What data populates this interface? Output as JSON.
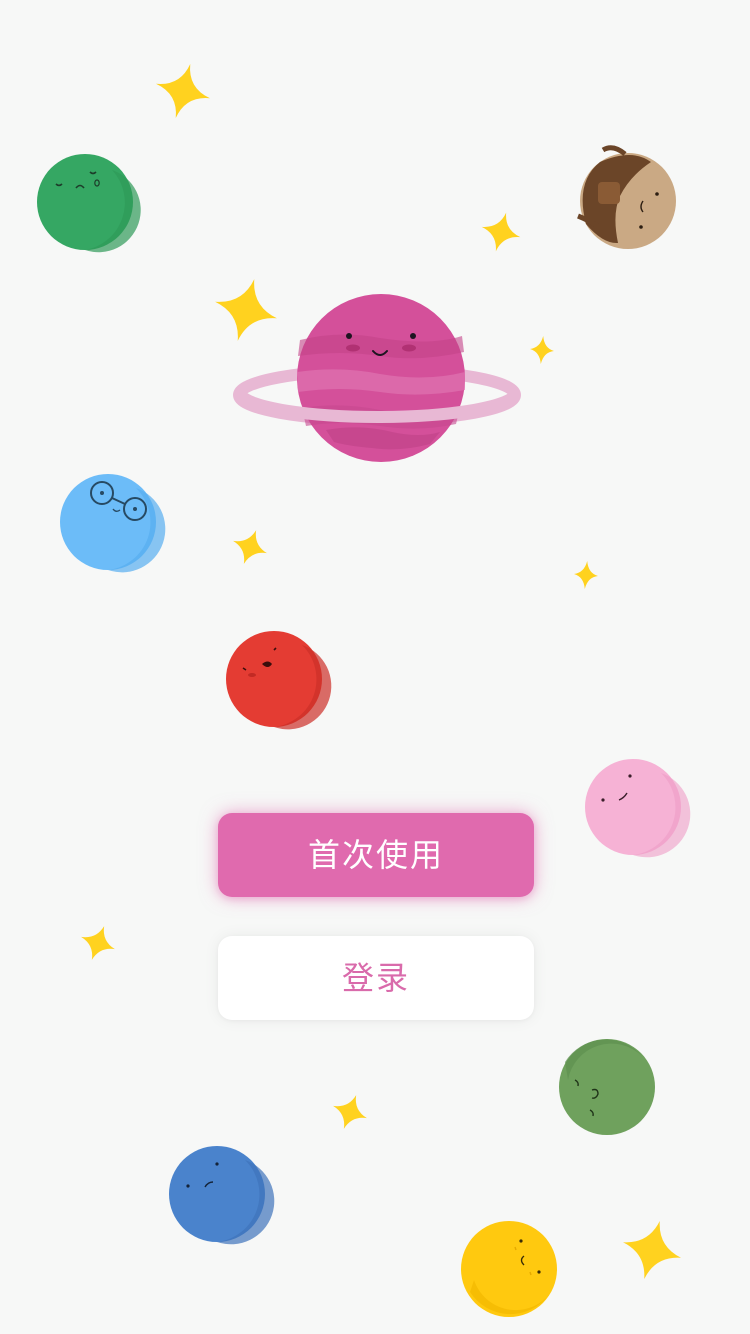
{
  "actions": {
    "first_use_label": "首次使用",
    "login_label": "登录"
  },
  "colors": {
    "background": "#f7f8f7",
    "accent_primary": "#e06aae",
    "accent_text": "#d96bab",
    "star": "#ffd21f"
  },
  "decorations": {
    "hero_planet": "ringed-magenta-planet-illustration",
    "star_icon": "sparkle-star-icon",
    "planets": [
      "green-planet-icon",
      "brown-backpack-planet-icon",
      "blue-glasses-planet-icon",
      "red-planet-icon",
      "pink-planet-icon",
      "olive-green-planet-icon",
      "blue-planet-icon",
      "yellow-planet-icon"
    ]
  }
}
